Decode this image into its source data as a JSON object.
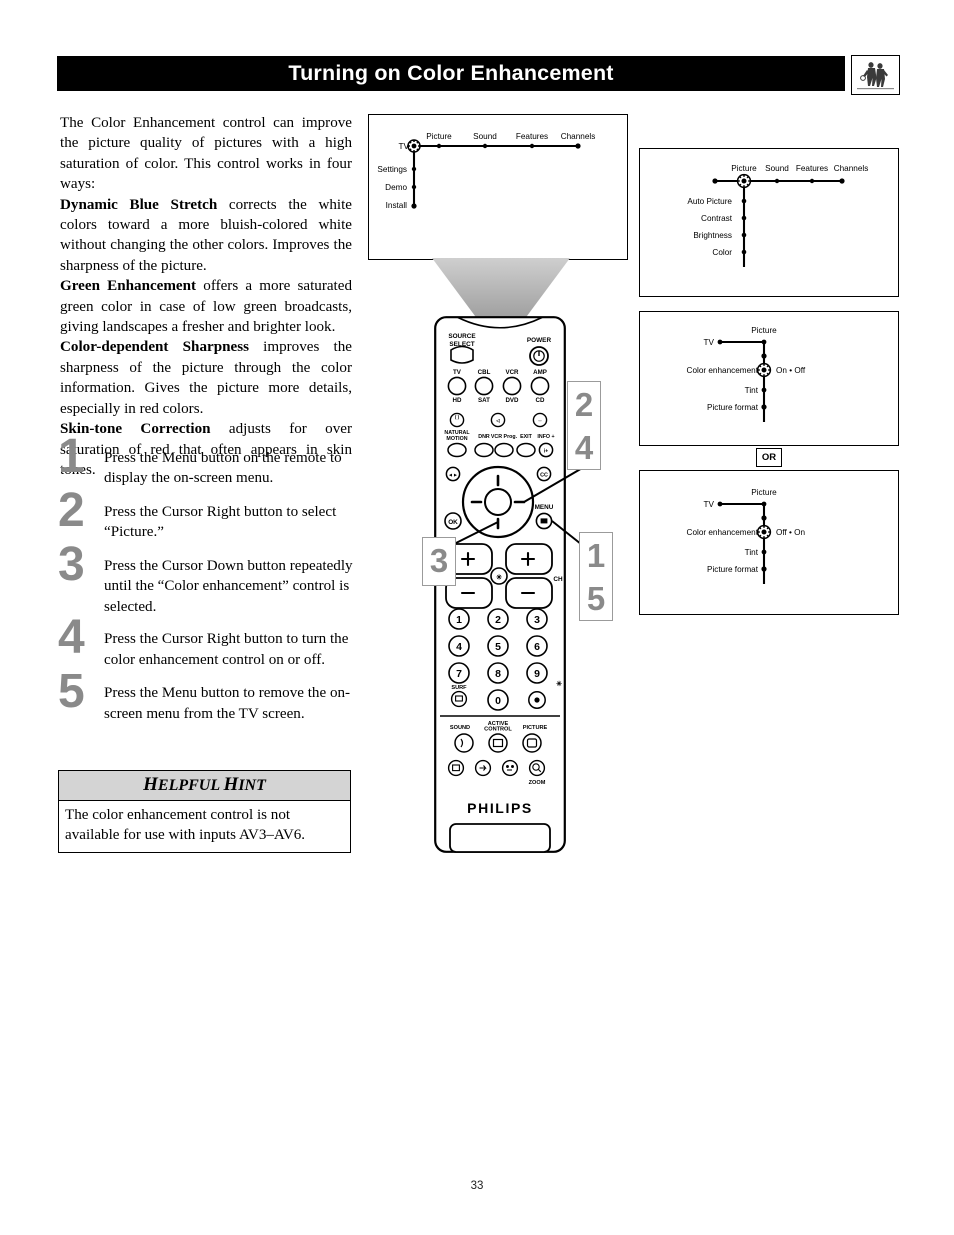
{
  "header": {
    "title": "Turning on Color Enhancement",
    "icon": "basketball-players-photo-icon"
  },
  "intro": {
    "para1": "The Color Enhancement control can improve the picture quality of pictures with a high saturation of color. This control works in four ways:",
    "features": [
      {
        "term": "Dynamic Blue Stretch",
        "text": " corrects the white colors toward a more bluish-colored white without changing the other colors. Improves the sharpness of the picture."
      },
      {
        "term": "Green Enhancement",
        "text": " offers a more saturated green color in case of low green broadcasts, giving landscapes a fresher and brighter look."
      },
      {
        "term": "Color-dependent Sharpness",
        "text": " improves the sharpness of the picture through the color information. Gives the picture more details, especially in red colors."
      },
      {
        "term": "Skin-tone Correction",
        "text": " adjusts for over saturation of red that often appears in skin tones."
      }
    ]
  },
  "steps": [
    {
      "num": "1",
      "text": "Press the Menu button on the remote to display the on-screen menu."
    },
    {
      "num": "2",
      "text": "Press the Cursor Right button to select “Picture.”"
    },
    {
      "num": "3",
      "text": "Press the Cursor Down button repeatedly until the “Color enhancement” control is selected."
    },
    {
      "num": "4",
      "text": "Press the Cursor Right button to turn the color enhancement control on or off."
    },
    {
      "num": "5",
      "text": "Press the Menu button to remove the on-screen menu from the TV screen."
    }
  ],
  "hint": {
    "title_first": "H",
    "title_rest1": "ELPFUL ",
    "title_second": "H",
    "title_rest2": "INT",
    "body": "The color enhancement control is not available for use with inputs AV3–AV6."
  },
  "menus": {
    "panel1": {
      "root": "TV",
      "top_items": [
        "Picture",
        "Sound",
        "Features",
        "Channels"
      ],
      "side_items": [
        "Settings",
        "Demo",
        "Install"
      ],
      "selected": "TV"
    },
    "panel2": {
      "top_items": [
        "Picture",
        "Sound",
        "Features",
        "Channels"
      ],
      "side_items": [
        "Auto Picture",
        "Contrast",
        "Brightness",
        "Color"
      ],
      "selected": "Picture"
    },
    "panel3": {
      "root": "TV",
      "branch": "Picture",
      "side_items": [
        "Color enhancement",
        "Tint",
        "Picture format"
      ],
      "selected": "Color enhancement",
      "options": "On • Off"
    },
    "panel4": {
      "root": "TV",
      "branch": "Picture",
      "side_items": [
        "Color enhancement",
        "Tint",
        "Picture format"
      ],
      "selected": "Color enhancement",
      "options": "Off • On"
    },
    "or_label": "OR"
  },
  "remote": {
    "source_select": "SOURCE\nSELECT",
    "source_select_l1": "SOURCE",
    "source_select_l2": "SELECT",
    "power": "POWER",
    "row1": [
      "TV",
      "CBL",
      "VCR",
      "AMP"
    ],
    "row2": [
      "HD",
      "SAT",
      "DVD",
      "CD"
    ],
    "natural_motion_l1": "NATURAL",
    "natural_motion_l2": "MOTION",
    "row3": [
      "DNR",
      "VCR Prog.",
      "EXIT",
      "INFO +"
    ],
    "ok": "OK",
    "menu": "MENU",
    "cc": "CC",
    "ch": "CH",
    "keys": [
      "1",
      "2",
      "3",
      "4",
      "5",
      "6",
      "7",
      "8",
      "9",
      "0"
    ],
    "surf": "SURF",
    "active_sound": "SOUND",
    "active_control_l1": "ACTIVE",
    "active_control_l2": "CONTROL",
    "active_picture": "PICTURE",
    "zoom": "ZOOM",
    "brand": "PHILIPS"
  },
  "callouts": {
    "top": [
      "2",
      "4"
    ],
    "bottom": [
      "1",
      "5"
    ],
    "left": [
      "3"
    ]
  },
  "page_number": "33",
  "colors": {
    "header_bg": "#000000",
    "header_text": "#ffffff",
    "step_number": "#8a8a8a",
    "hint_header_bg": "#d4d4d4",
    "beam": "#b5b5b5"
  }
}
